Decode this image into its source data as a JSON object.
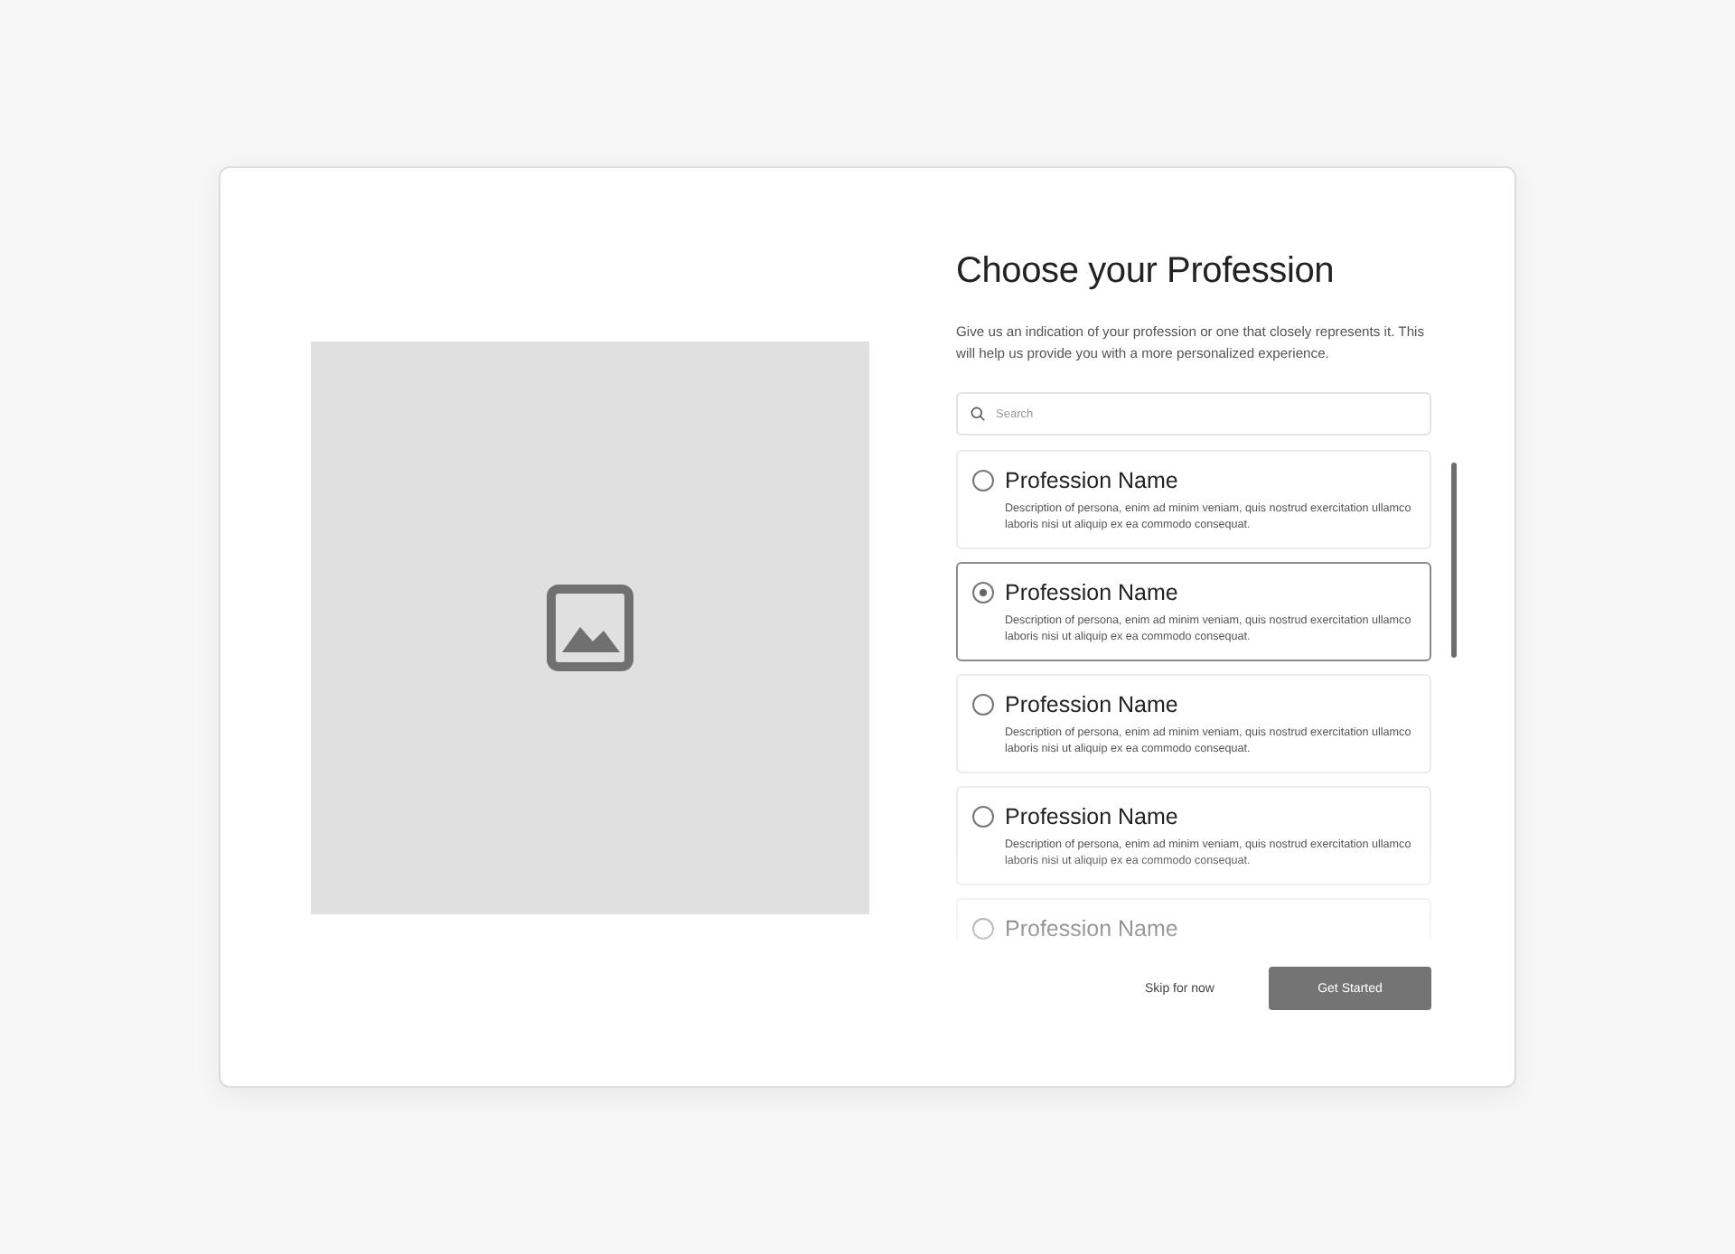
{
  "title": "Choose your Profession",
  "subtitle": "Give us an indication of your profession or one that closely represents it. This will help us provide you with a more personalized experience.",
  "search": {
    "placeholder": "Search"
  },
  "professions": [
    {
      "name": "Profession Name",
      "description": "Description of persona, enim ad minim veniam, quis nostrud exercitation ullamco laboris nisi ut aliquip ex ea commodo consequat.",
      "selected": false
    },
    {
      "name": "Profession Name",
      "description": "Description of persona, enim ad minim veniam, quis nostrud exercitation ullamco laboris nisi ut aliquip ex ea commodo consequat.",
      "selected": true
    },
    {
      "name": "Profession Name",
      "description": "Description of persona, enim ad minim veniam, quis nostrud exercitation ullamco laboris nisi ut aliquip ex ea commodo consequat.",
      "selected": false
    },
    {
      "name": "Profession Name",
      "description": "Description of persona, enim ad minim veniam, quis nostrud exercitation ullamco laboris nisi ut aliquip ex ea commodo consequat.",
      "selected": false
    },
    {
      "name": "Profession Name",
      "selected": false
    }
  ],
  "buttons": {
    "skip": "Skip for now",
    "primary": "Get Started"
  }
}
